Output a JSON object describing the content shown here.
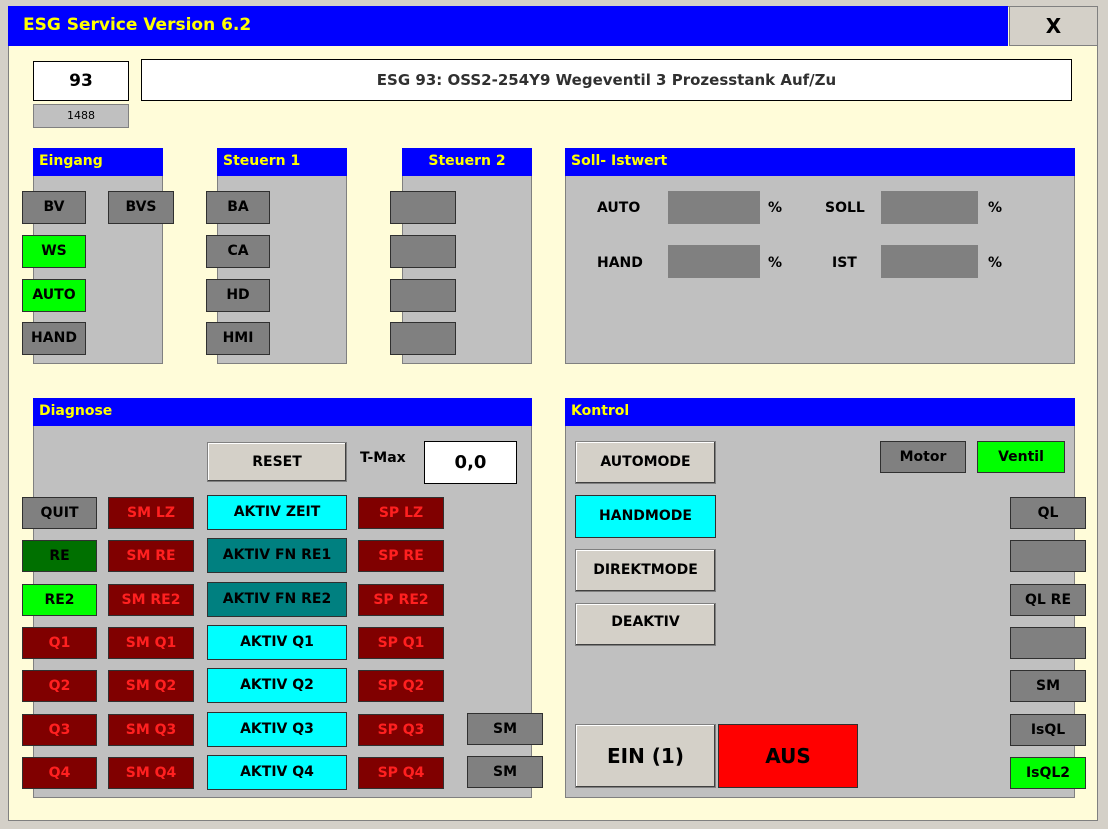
{
  "window": {
    "title": "ESG Service Version 6.2",
    "close_label": "X"
  },
  "header": {
    "esg_number": "93",
    "sub_number": "1488",
    "description": "ESG 93: OSS2-254Y9 Wegeventil 3 Prozesstank Auf/Zu"
  },
  "eingang": {
    "title": "Eingang",
    "bv": "BV",
    "bvs": "BVS",
    "ws": "WS",
    "auto": "AUTO",
    "hand": "HAND"
  },
  "steuern1": {
    "title": "Steuern 1",
    "items": [
      "BA",
      "CA",
      "HD",
      "HMI"
    ]
  },
  "steuern2": {
    "title": "Steuern 2"
  },
  "sollist": {
    "title": "Soll- Istwert",
    "auto": "AUTO",
    "hand": "HAND",
    "soll": "SOLL",
    "ist": "IST",
    "unit": "%"
  },
  "diagnose": {
    "title": "Diagnose",
    "reset": "RESET",
    "tmax_label": "T-Max",
    "tmax_value": "0,0",
    "col1": [
      "QUIT",
      "RE",
      "RE2",
      "Q1",
      "Q2",
      "Q3",
      "Q4"
    ],
    "col2": [
      "SM LZ",
      "SM RE",
      "SM RE2",
      "SM Q1",
      "SM Q2",
      "SM Q3",
      "SM Q4"
    ],
    "col3": [
      "AKTIV ZEIT",
      "AKTIV FN RE1",
      "AKTIV FN RE2",
      "AKTIV Q1",
      "AKTIV Q2",
      "AKTIV Q3",
      "AKTIV Q4"
    ],
    "col4": [
      "SP LZ",
      "SP RE",
      "SP RE2",
      "SP Q1",
      "SP Q2",
      "SP Q3",
      "SP Q4"
    ],
    "sm1": "SM",
    "sm2": "SM"
  },
  "kontrol": {
    "title": "Kontrol",
    "automode": "AUTOMODE",
    "handmode": "HANDMODE",
    "direktmode": "DIREKTMODE",
    "deaktiv": "DEAKTIV",
    "motor": "Motor",
    "ventil": "Ventil",
    "ein": "EIN (1)",
    "aus": "AUS",
    "right": [
      "QL",
      "",
      "QL RE",
      "",
      "SM",
      "IsQL",
      "IsQL2"
    ]
  },
  "colors": {
    "title_bar": "#0000ff",
    "title_text": "#ffff00",
    "active_green": "#00ff00",
    "dark_red": "#800000",
    "cyan": "#00ffff",
    "aus_red": "#ff0000"
  }
}
